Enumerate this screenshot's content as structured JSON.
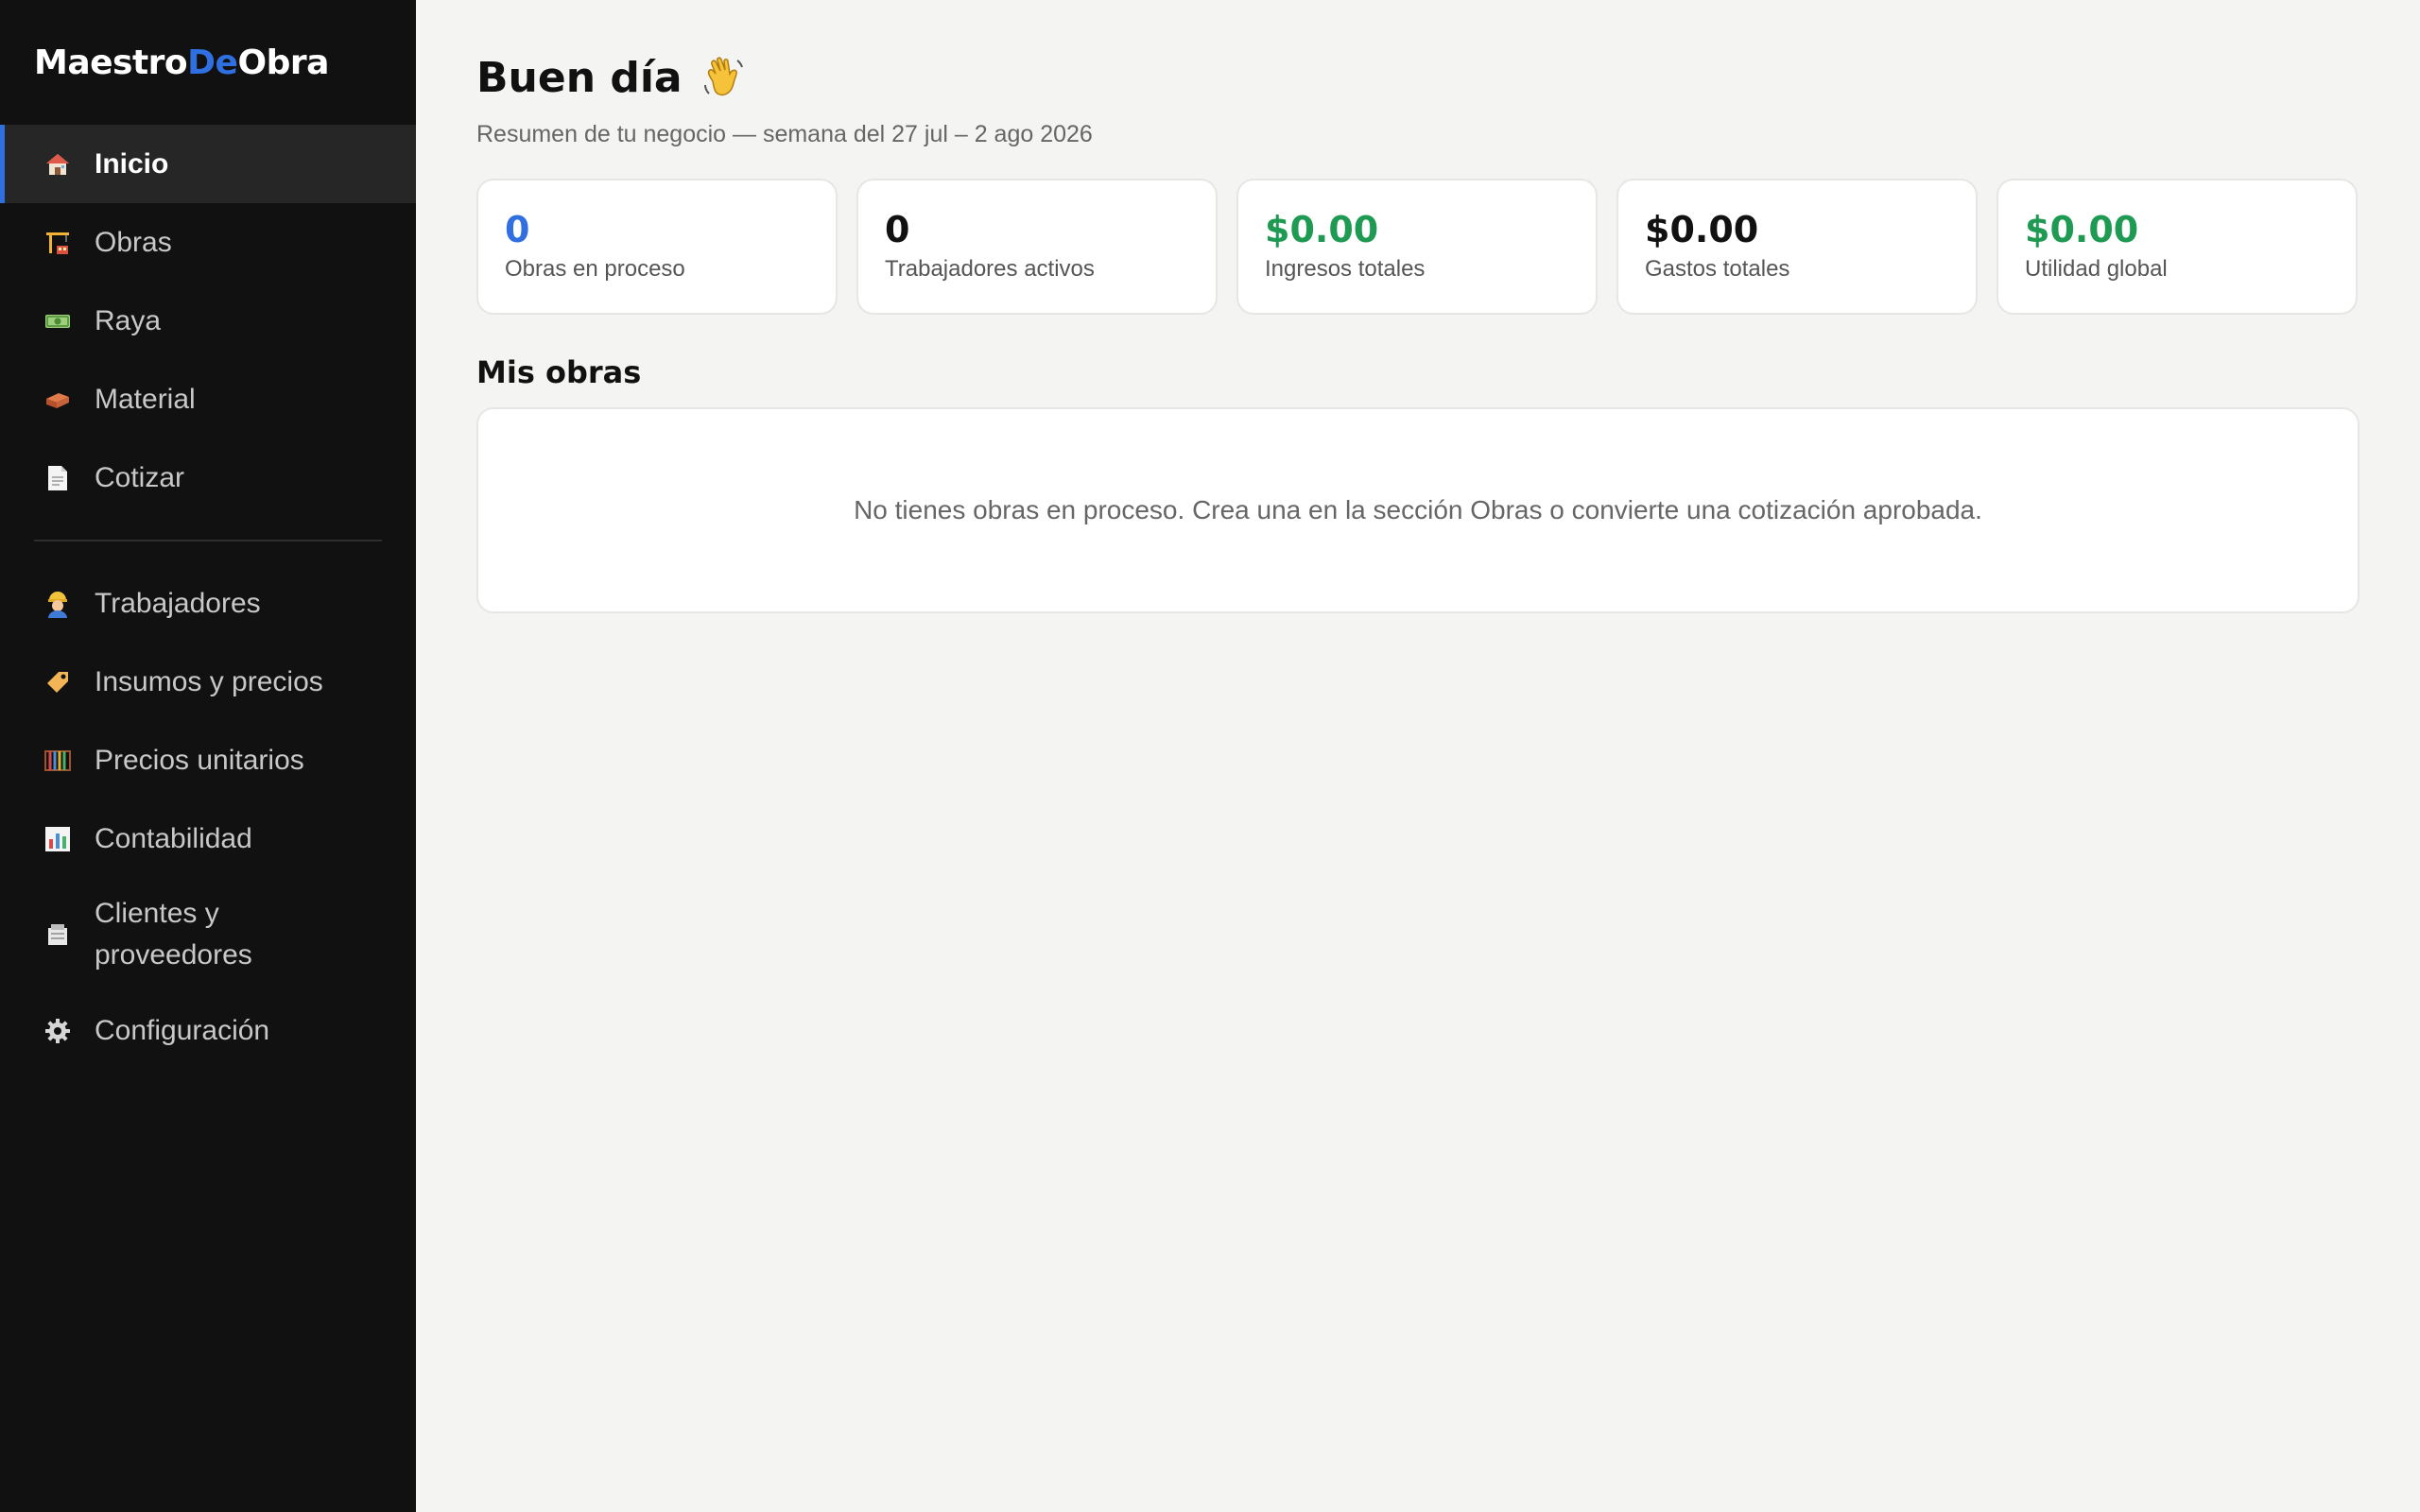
{
  "brand": {
    "part1": "Maestro",
    "part2": "De",
    "part3": "Obra"
  },
  "colors": {
    "accent": "#2f6fe0",
    "positive": "#1f9a52",
    "sidebar_bg": "#111111",
    "page_bg": "#f4f4f2"
  },
  "sidebar": {
    "items": [
      {
        "label": "Inicio",
        "icon": "house-icon",
        "active": true
      },
      {
        "label": "Obras",
        "icon": "crane-icon"
      },
      {
        "label": "Raya",
        "icon": "banknote-icon"
      },
      {
        "label": "Material",
        "icon": "brick-icon"
      },
      {
        "label": "Cotizar",
        "icon": "document-icon"
      },
      {
        "label": "Trabajadores",
        "icon": "construction-worker-icon"
      },
      {
        "label": "Insumos y precios",
        "icon": "price-tag-icon"
      },
      {
        "label": "Precios unitarios",
        "icon": "abacus-icon"
      },
      {
        "label": "Contabilidad",
        "icon": "bar-chart-icon"
      },
      {
        "label": "Clientes y proveedores",
        "icon": "card-index-icon"
      },
      {
        "label": "Configuración",
        "icon": "gear-icon"
      }
    ]
  },
  "header": {
    "greeting": "Buen día",
    "greeting_icon": "waving-hand-icon",
    "subtitle": "Resumen de tu negocio — semana del 27 jul – 2 ago 2026"
  },
  "stats": [
    {
      "value": "0",
      "label": "Obras en proceso",
      "color": "#2f6fe0"
    },
    {
      "value": "0",
      "label": "Trabajadores activos",
      "color": "#111111"
    },
    {
      "value": "$0.00",
      "label": "Ingresos totales",
      "color": "#1f9a52"
    },
    {
      "value": "$0.00",
      "label": "Gastos totales",
      "color": "#111111"
    },
    {
      "value": "$0.00",
      "label": "Utilidad global",
      "color": "#1f9a52"
    }
  ],
  "obras": {
    "title": "Mis obras",
    "empty_message": "No tienes obras en proceso. Crea una en la sección Obras o convierte una cotización aprobada."
  }
}
